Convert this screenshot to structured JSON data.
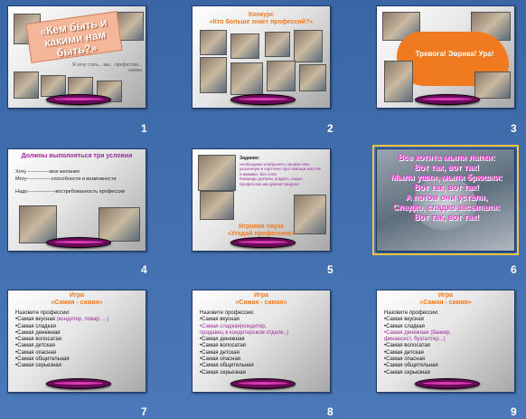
{
  "slides": [
    {
      "number": "1",
      "title": "«Кем быть и какими нам быть?»",
      "subtitle": "Я хочу стать... мы... профессии... нужны"
    },
    {
      "number": "2",
      "title": "Конкурс\n«Кто больше знает профессий?»"
    },
    {
      "number": "3",
      "title": "Тревога! Эврика! Ура!"
    },
    {
      "number": "4",
      "title": "Должны выполняться три условия",
      "items": [
        "Хочу -------------мои желания",
        "Могу---------------способности и возможности",
        "Надо-----------------востребованность профессии"
      ]
    },
    {
      "number": "5",
      "task_label": "Задание:",
      "task_text": "необходимо изобразить профессию, указанную в карточке при помощи жестов и мимики, без слов.\nКоманды должны угадать, какую профессию им демонстрируют",
      "title": "Игровая пауза\n«Угадай профессию»"
    },
    {
      "number": "6",
      "poem": "Все котята мыли лапки:\nВот так, вот так!\nМыли ушки, мыли брюшки:\nВот так, вот так!\nА потом они устали,\nСладко, сладко засыпали:\nВот так, вот так!"
    },
    {
      "number": "7",
      "title": "Игра\n«Самая - самая»",
      "lead": "Назовите профессии:",
      "items": [
        "•Самая вкусная",
        "(кондитер, повар, ...)",
        "•Самая сладкая",
        "•Самая денежная",
        "•Самая волосатая",
        "•Самая детская",
        "•Самая опасная",
        "•Самая общительная",
        "•Самая серьезная"
      ]
    },
    {
      "number": "8",
      "title": "Игра\n«Самая - самая»",
      "lead": "Назовите профессии:",
      "items": [
        "•Самая вкусная",
        "•Самая сладкая(кондитер,",
        "продавец в кондитерском отделе..)",
        "•Самая денежная",
        "•Самая волосатая",
        "•Самая детская",
        "•Самая опасная",
        "•Самая общительная",
        "•Самая серьезная"
      ]
    },
    {
      "number": "9",
      "title": "Игра\n«Самая - самая»",
      "lead": "Назовите профессии:",
      "items": [
        "•Самая вкусная",
        "•Самая сладкая",
        "•Самая денежная (банкир,",
        "финансист, бухгалтер...)",
        "•Самая волосатая",
        "•Самая детская",
        "•Самая опасная",
        "•Самая общительная",
        "•Самая серьезная"
      ]
    }
  ],
  "selected_slide": "6",
  "colors": {
    "background": "#3f6ba9",
    "accent_orange": "#f07a1f",
    "accent_purple": "#9c2a9c",
    "pink_text": "#e040c8"
  }
}
